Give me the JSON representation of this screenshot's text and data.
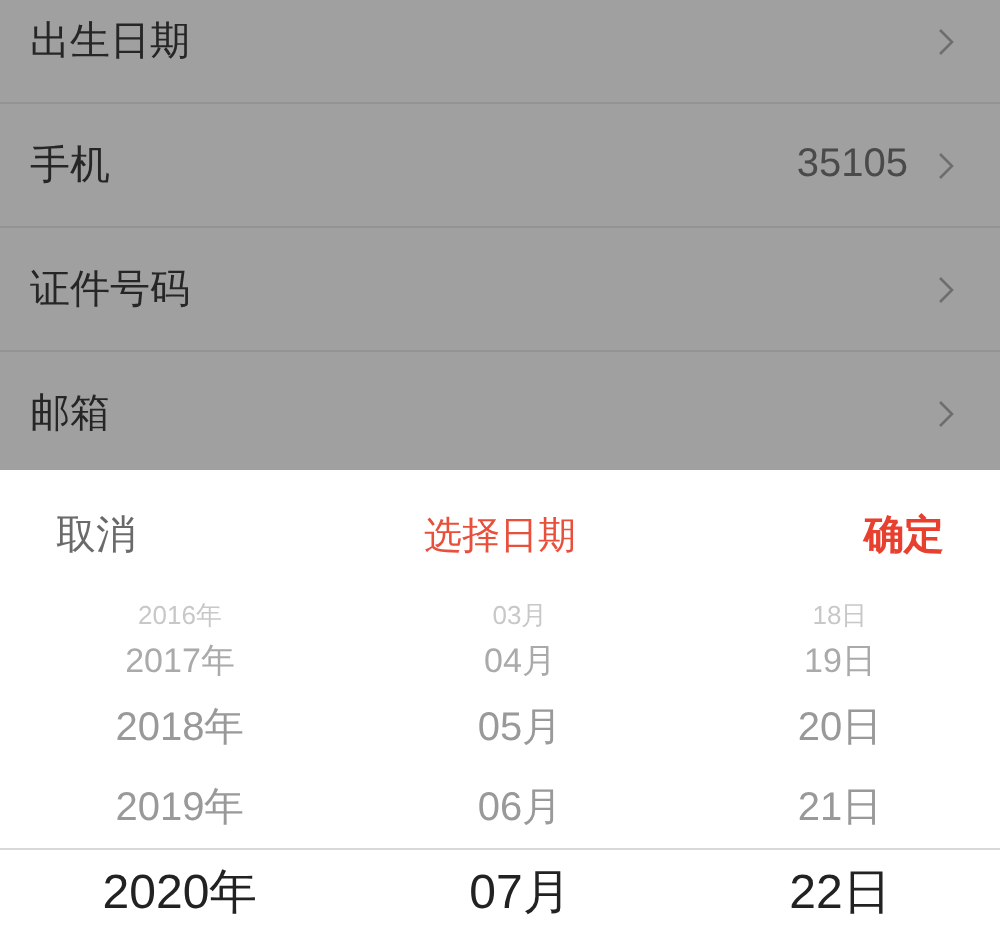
{
  "form_rows": [
    {
      "label": "出生日期"
    },
    {
      "label": "手机",
      "value": "35105"
    },
    {
      "label": "证件号码"
    },
    {
      "label": "邮箱"
    }
  ],
  "picker": {
    "cancel": "取消",
    "title": "选择日期",
    "confirm": "确定",
    "columns": [
      {
        "items": [
          {
            "text": "2016年",
            "selected": false
          },
          {
            "text": "2017年",
            "selected": false
          },
          {
            "text": "2018年",
            "selected": false
          },
          {
            "text": "2019年",
            "selected": false
          },
          {
            "text": "2020年",
            "selected": true
          }
        ]
      },
      {
        "items": [
          {
            "text": "03月",
            "selected": false
          },
          {
            "text": "04月",
            "selected": false
          },
          {
            "text": "05月",
            "selected": false
          },
          {
            "text": "06月",
            "selected": false
          },
          {
            "text": "07月",
            "selected": true
          }
        ]
      },
      {
        "items": [
          {
            "text": "18日",
            "selected": false
          },
          {
            "text": "19日",
            "selected": false
          },
          {
            "text": "20日",
            "selected": false
          },
          {
            "text": "21日",
            "selected": false
          },
          {
            "text": "22日",
            "selected": true
          }
        ]
      }
    ]
  }
}
